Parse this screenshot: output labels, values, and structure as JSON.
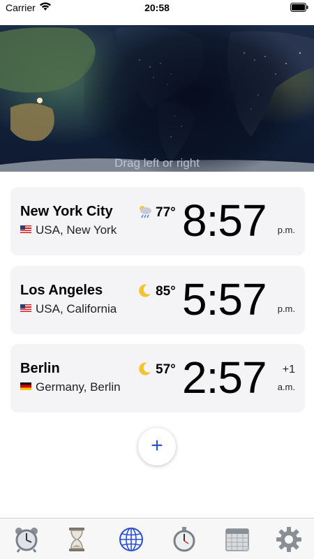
{
  "status_bar": {
    "carrier": "Carrier",
    "time": "20:58"
  },
  "map": {
    "hint": "Drag left or right"
  },
  "cities": [
    {
      "name": "New York City",
      "region": "USA, New York",
      "flag": "us-flag",
      "weather_icon": "cloud-rain-sun-icon",
      "temp": "77°",
      "time": "8:57",
      "period": "p.m.",
      "offset": ""
    },
    {
      "name": "Los Angeles",
      "region": "USA, California",
      "flag": "us-flag",
      "weather_icon": "moon-icon",
      "temp": "85°",
      "time": "5:57",
      "period": "p.m.",
      "offset": ""
    },
    {
      "name": "Berlin",
      "region": "Germany, Berlin",
      "flag": "de-flag",
      "weather_icon": "moon-icon",
      "temp": "57°",
      "time": "2:57",
      "period": "a.m.",
      "offset": "+1"
    }
  ],
  "add_button": {
    "label": "+"
  },
  "tabs": [
    {
      "icon": "alarm-clock-icon",
      "active": false
    },
    {
      "icon": "hourglass-icon",
      "active": false
    },
    {
      "icon": "globe-icon",
      "active": true
    },
    {
      "icon": "stopwatch-icon",
      "active": false
    },
    {
      "icon": "calendar-icon",
      "active": false
    },
    {
      "icon": "settings-gear-icon",
      "active": false
    }
  ],
  "colors": {
    "accent": "#2a4fd6",
    "card_bg": "#f4f4f6"
  }
}
